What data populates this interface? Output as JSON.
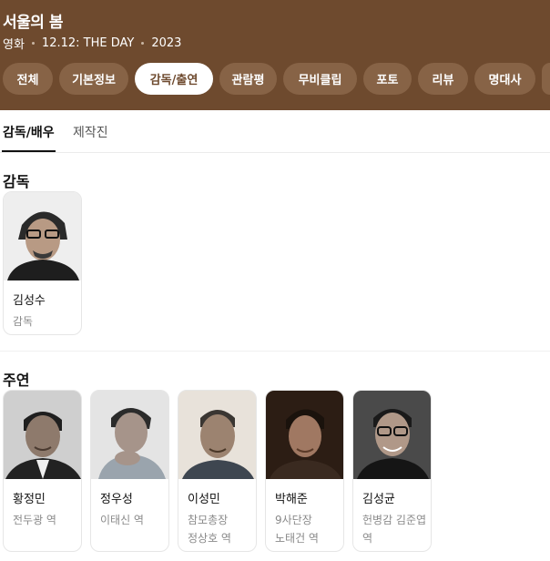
{
  "movie": {
    "title": "서울의 봄",
    "meta": [
      "영화",
      "12.12: THE DAY",
      "2023"
    ]
  },
  "tabs": [
    {
      "label": "전체",
      "active": false
    },
    {
      "label": "기본정보",
      "active": false
    },
    {
      "label": "감독/출연",
      "active": true
    },
    {
      "label": "관람평",
      "active": false
    },
    {
      "label": "무비클립",
      "active": false
    },
    {
      "label": "포토",
      "active": false
    },
    {
      "label": "리뷰",
      "active": false
    },
    {
      "label": "명대사",
      "active": false
    }
  ],
  "subtabs": [
    {
      "label": "감독/배우",
      "active": true
    },
    {
      "label": "제작진",
      "active": false
    }
  ],
  "sections": {
    "director": {
      "title": "감독",
      "people": [
        {
          "name": "김성수",
          "role": "감독"
        }
      ]
    },
    "cast": {
      "title": "주연",
      "people": [
        {
          "name": "황정민",
          "role": "전두광 역"
        },
        {
          "name": "정우성",
          "role": "이태신 역"
        },
        {
          "name": "이성민",
          "role": "참모총장 정상호 역"
        },
        {
          "name": "박해준",
          "role": "9사단장 노태건 역"
        },
        {
          "name": "김성균",
          "role": "헌병감 김준엽 역"
        }
      ]
    }
  },
  "colors": {
    "header_bg": "#6e4a2e",
    "tab_bg": "#876346",
    "active_tab_text": "#6e4a2e"
  }
}
